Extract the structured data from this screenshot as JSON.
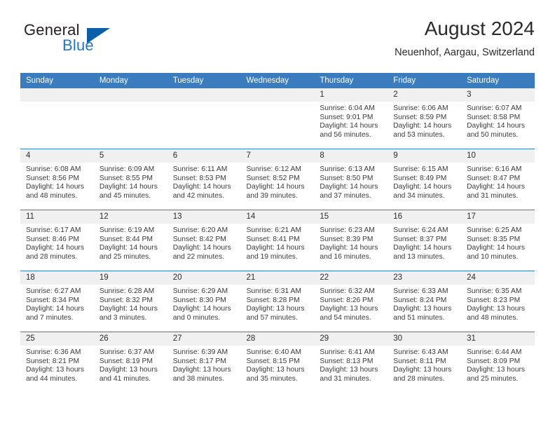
{
  "brand": {
    "name_part1": "General",
    "name_part2": "Blue",
    "triangle_color": "#0b5ea8",
    "blue_text_color": "#2079c7"
  },
  "header": {
    "title": "August 2024",
    "subtitle": "Neuenhof, Aargau, Switzerland",
    "header_bg_color": "#3a7cbe",
    "daynum_bg_color": "#f0f0f0"
  },
  "weekdays": [
    "Sunday",
    "Monday",
    "Tuesday",
    "Wednesday",
    "Thursday",
    "Friday",
    "Saturday"
  ],
  "labels": {
    "sunrise_prefix": "Sunrise:",
    "sunset_prefix": "Sunset:",
    "daylight_prefix": "Daylight:"
  },
  "weeks": [
    [
      {
        "day": "",
        "blank": true
      },
      {
        "day": "",
        "blank": true
      },
      {
        "day": "",
        "blank": true
      },
      {
        "day": "",
        "blank": true
      },
      {
        "day": "1",
        "sunrise": "Sunrise: 6:04 AM",
        "sunset": "Sunset: 9:01 PM",
        "daylight_line1": "Daylight: 14 hours",
        "daylight_line2": "and 56 minutes."
      },
      {
        "day": "2",
        "sunrise": "Sunrise: 6:06 AM",
        "sunset": "Sunset: 8:59 PM",
        "daylight_line1": "Daylight: 14 hours",
        "daylight_line2": "and 53 minutes."
      },
      {
        "day": "3",
        "sunrise": "Sunrise: 6:07 AM",
        "sunset": "Sunset: 8:58 PM",
        "daylight_line1": "Daylight: 14 hours",
        "daylight_line2": "and 50 minutes."
      }
    ],
    [
      {
        "day": "4",
        "sunrise": "Sunrise: 6:08 AM",
        "sunset": "Sunset: 8:56 PM",
        "daylight_line1": "Daylight: 14 hours",
        "daylight_line2": "and 48 minutes."
      },
      {
        "day": "5",
        "sunrise": "Sunrise: 6:09 AM",
        "sunset": "Sunset: 8:55 PM",
        "daylight_line1": "Daylight: 14 hours",
        "daylight_line2": "and 45 minutes."
      },
      {
        "day": "6",
        "sunrise": "Sunrise: 6:11 AM",
        "sunset": "Sunset: 8:53 PM",
        "daylight_line1": "Daylight: 14 hours",
        "daylight_line2": "and 42 minutes."
      },
      {
        "day": "7",
        "sunrise": "Sunrise: 6:12 AM",
        "sunset": "Sunset: 8:52 PM",
        "daylight_line1": "Daylight: 14 hours",
        "daylight_line2": "and 39 minutes."
      },
      {
        "day": "8",
        "sunrise": "Sunrise: 6:13 AM",
        "sunset": "Sunset: 8:50 PM",
        "daylight_line1": "Daylight: 14 hours",
        "daylight_line2": "and 37 minutes."
      },
      {
        "day": "9",
        "sunrise": "Sunrise: 6:15 AM",
        "sunset": "Sunset: 8:49 PM",
        "daylight_line1": "Daylight: 14 hours",
        "daylight_line2": "and 34 minutes."
      },
      {
        "day": "10",
        "sunrise": "Sunrise: 6:16 AM",
        "sunset": "Sunset: 8:47 PM",
        "daylight_line1": "Daylight: 14 hours",
        "daylight_line2": "and 31 minutes."
      }
    ],
    [
      {
        "day": "11",
        "sunrise": "Sunrise: 6:17 AM",
        "sunset": "Sunset: 8:46 PM",
        "daylight_line1": "Daylight: 14 hours",
        "daylight_line2": "and 28 minutes."
      },
      {
        "day": "12",
        "sunrise": "Sunrise: 6:19 AM",
        "sunset": "Sunset: 8:44 PM",
        "daylight_line1": "Daylight: 14 hours",
        "daylight_line2": "and 25 minutes."
      },
      {
        "day": "13",
        "sunrise": "Sunrise: 6:20 AM",
        "sunset": "Sunset: 8:42 PM",
        "daylight_line1": "Daylight: 14 hours",
        "daylight_line2": "and 22 minutes."
      },
      {
        "day": "14",
        "sunrise": "Sunrise: 6:21 AM",
        "sunset": "Sunset: 8:41 PM",
        "daylight_line1": "Daylight: 14 hours",
        "daylight_line2": "and 19 minutes."
      },
      {
        "day": "15",
        "sunrise": "Sunrise: 6:23 AM",
        "sunset": "Sunset: 8:39 PM",
        "daylight_line1": "Daylight: 14 hours",
        "daylight_line2": "and 16 minutes."
      },
      {
        "day": "16",
        "sunrise": "Sunrise: 6:24 AM",
        "sunset": "Sunset: 8:37 PM",
        "daylight_line1": "Daylight: 14 hours",
        "daylight_line2": "and 13 minutes."
      },
      {
        "day": "17",
        "sunrise": "Sunrise: 6:25 AM",
        "sunset": "Sunset: 8:35 PM",
        "daylight_line1": "Daylight: 14 hours",
        "daylight_line2": "and 10 minutes."
      }
    ],
    [
      {
        "day": "18",
        "sunrise": "Sunrise: 6:27 AM",
        "sunset": "Sunset: 8:34 PM",
        "daylight_line1": "Daylight: 14 hours",
        "daylight_line2": "and 7 minutes."
      },
      {
        "day": "19",
        "sunrise": "Sunrise: 6:28 AM",
        "sunset": "Sunset: 8:32 PM",
        "daylight_line1": "Daylight: 14 hours",
        "daylight_line2": "and 3 minutes."
      },
      {
        "day": "20",
        "sunrise": "Sunrise: 6:29 AM",
        "sunset": "Sunset: 8:30 PM",
        "daylight_line1": "Daylight: 14 hours",
        "daylight_line2": "and 0 minutes."
      },
      {
        "day": "21",
        "sunrise": "Sunrise: 6:31 AM",
        "sunset": "Sunset: 8:28 PM",
        "daylight_line1": "Daylight: 13 hours",
        "daylight_line2": "and 57 minutes."
      },
      {
        "day": "22",
        "sunrise": "Sunrise: 6:32 AM",
        "sunset": "Sunset: 8:26 PM",
        "daylight_line1": "Daylight: 13 hours",
        "daylight_line2": "and 54 minutes."
      },
      {
        "day": "23",
        "sunrise": "Sunrise: 6:33 AM",
        "sunset": "Sunset: 8:24 PM",
        "daylight_line1": "Daylight: 13 hours",
        "daylight_line2": "and 51 minutes."
      },
      {
        "day": "24",
        "sunrise": "Sunrise: 6:35 AM",
        "sunset": "Sunset: 8:23 PM",
        "daylight_line1": "Daylight: 13 hours",
        "daylight_line2": "and 48 minutes."
      }
    ],
    [
      {
        "day": "25",
        "sunrise": "Sunrise: 6:36 AM",
        "sunset": "Sunset: 8:21 PM",
        "daylight_line1": "Daylight: 13 hours",
        "daylight_line2": "and 44 minutes."
      },
      {
        "day": "26",
        "sunrise": "Sunrise: 6:37 AM",
        "sunset": "Sunset: 8:19 PM",
        "daylight_line1": "Daylight: 13 hours",
        "daylight_line2": "and 41 minutes."
      },
      {
        "day": "27",
        "sunrise": "Sunrise: 6:39 AM",
        "sunset": "Sunset: 8:17 PM",
        "daylight_line1": "Daylight: 13 hours",
        "daylight_line2": "and 38 minutes."
      },
      {
        "day": "28",
        "sunrise": "Sunrise: 6:40 AM",
        "sunset": "Sunset: 8:15 PM",
        "daylight_line1": "Daylight: 13 hours",
        "daylight_line2": "and 35 minutes."
      },
      {
        "day": "29",
        "sunrise": "Sunrise: 6:41 AM",
        "sunset": "Sunset: 8:13 PM",
        "daylight_line1": "Daylight: 13 hours",
        "daylight_line2": "and 31 minutes."
      },
      {
        "day": "30",
        "sunrise": "Sunrise: 6:43 AM",
        "sunset": "Sunset: 8:11 PM",
        "daylight_line1": "Daylight: 13 hours",
        "daylight_line2": "and 28 minutes."
      },
      {
        "day": "31",
        "sunrise": "Sunrise: 6:44 AM",
        "sunset": "Sunset: 8:09 PM",
        "daylight_line1": "Daylight: 13 hours",
        "daylight_line2": "and 25 minutes."
      }
    ]
  ]
}
